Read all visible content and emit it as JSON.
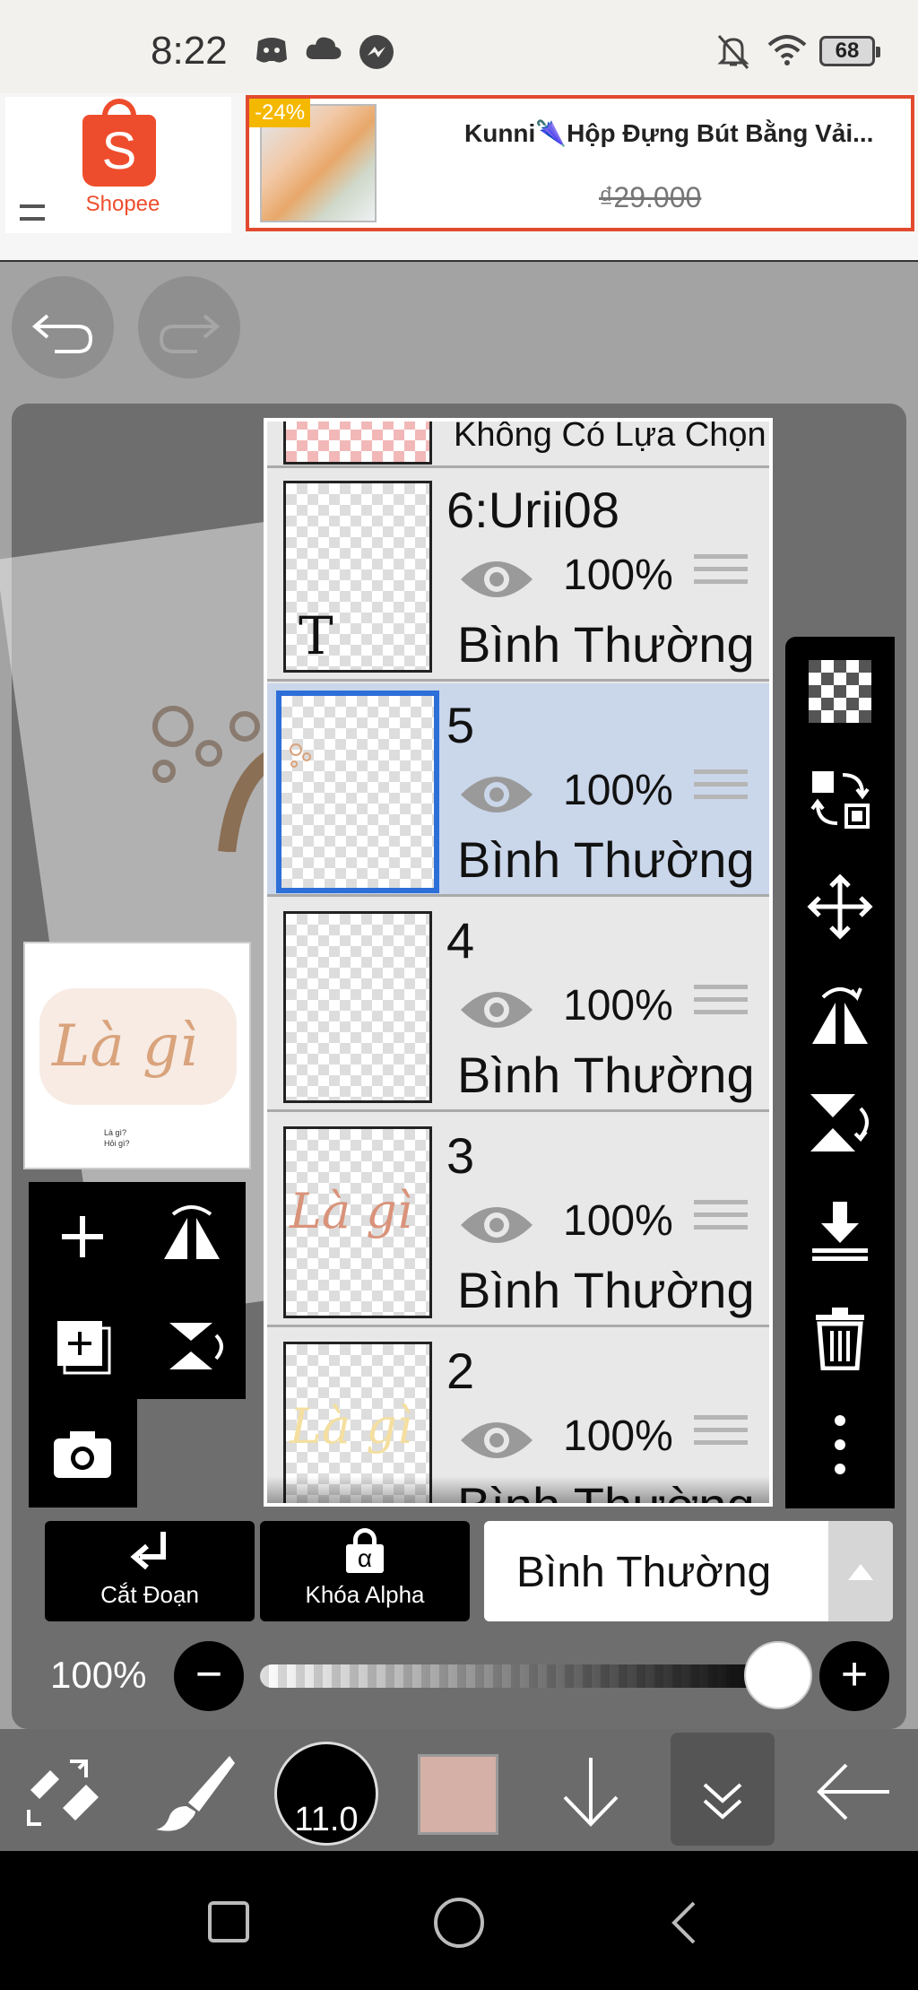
{
  "status_bar": {
    "time": "8:22",
    "battery": "68"
  },
  "ad": {
    "brand_text": "Shopee",
    "brand_letter": "S",
    "discount": "-24%",
    "product_title": "Kunni🌂Hộp Đựng Bút Bằng Vải...",
    "price": "₫29.000"
  },
  "thumbnail": {
    "text": "Là gì",
    "small_text_1": "Là gì?",
    "small_text_2": "Hỏi gì?"
  },
  "layers": {
    "top_partial_label": "Không Có Lựa Chọn",
    "items": [
      {
        "name": "6:Urii08",
        "opacity": "100%",
        "blend": "Bình Thường",
        "thumb_text": "T"
      },
      {
        "name": "5",
        "opacity": "100%",
        "blend": "Bình Thường",
        "selected": true
      },
      {
        "name": "4",
        "opacity": "100%",
        "blend": "Bình Thường"
      },
      {
        "name": "3",
        "opacity": "100%",
        "blend": "Bình Thường",
        "thumb_text": "Là gì"
      },
      {
        "name": "2",
        "opacity": "100%",
        "blend": "Bình Thường",
        "thumb_text": "Là gì"
      }
    ]
  },
  "controls": {
    "cut_label": "Cắt Đoạn",
    "alpha_label": "Khóa Alpha",
    "alpha_glyph": "α",
    "blend_mode": "Bình Thường",
    "opacity": "100%",
    "opacity_value": 1.0,
    "minus": "−",
    "plus": "+"
  },
  "bottom_toolbar": {
    "brush_size": "11.0",
    "color": "#d5b0a6"
  }
}
